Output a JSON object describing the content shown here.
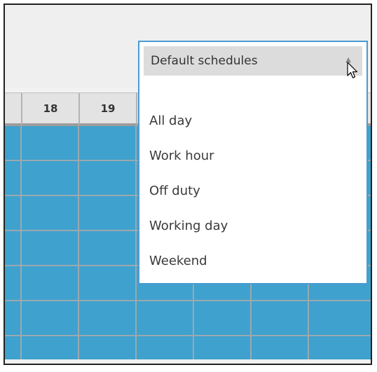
{
  "schedule_grid": {
    "hour_headers": [
      "",
      "18",
      "19",
      "",
      "",
      "",
      ""
    ],
    "cell_color": "#3fa1cd"
  },
  "dropdown": {
    "selected": "Default schedules",
    "icon": "chevron-up-icon",
    "options": [
      "All day",
      "Work hour",
      "Off duty",
      "Working day",
      "Weekend"
    ],
    "border_color": "#4a9bd2"
  },
  "cursor": {
    "icon": "mouse-pointer-icon"
  }
}
